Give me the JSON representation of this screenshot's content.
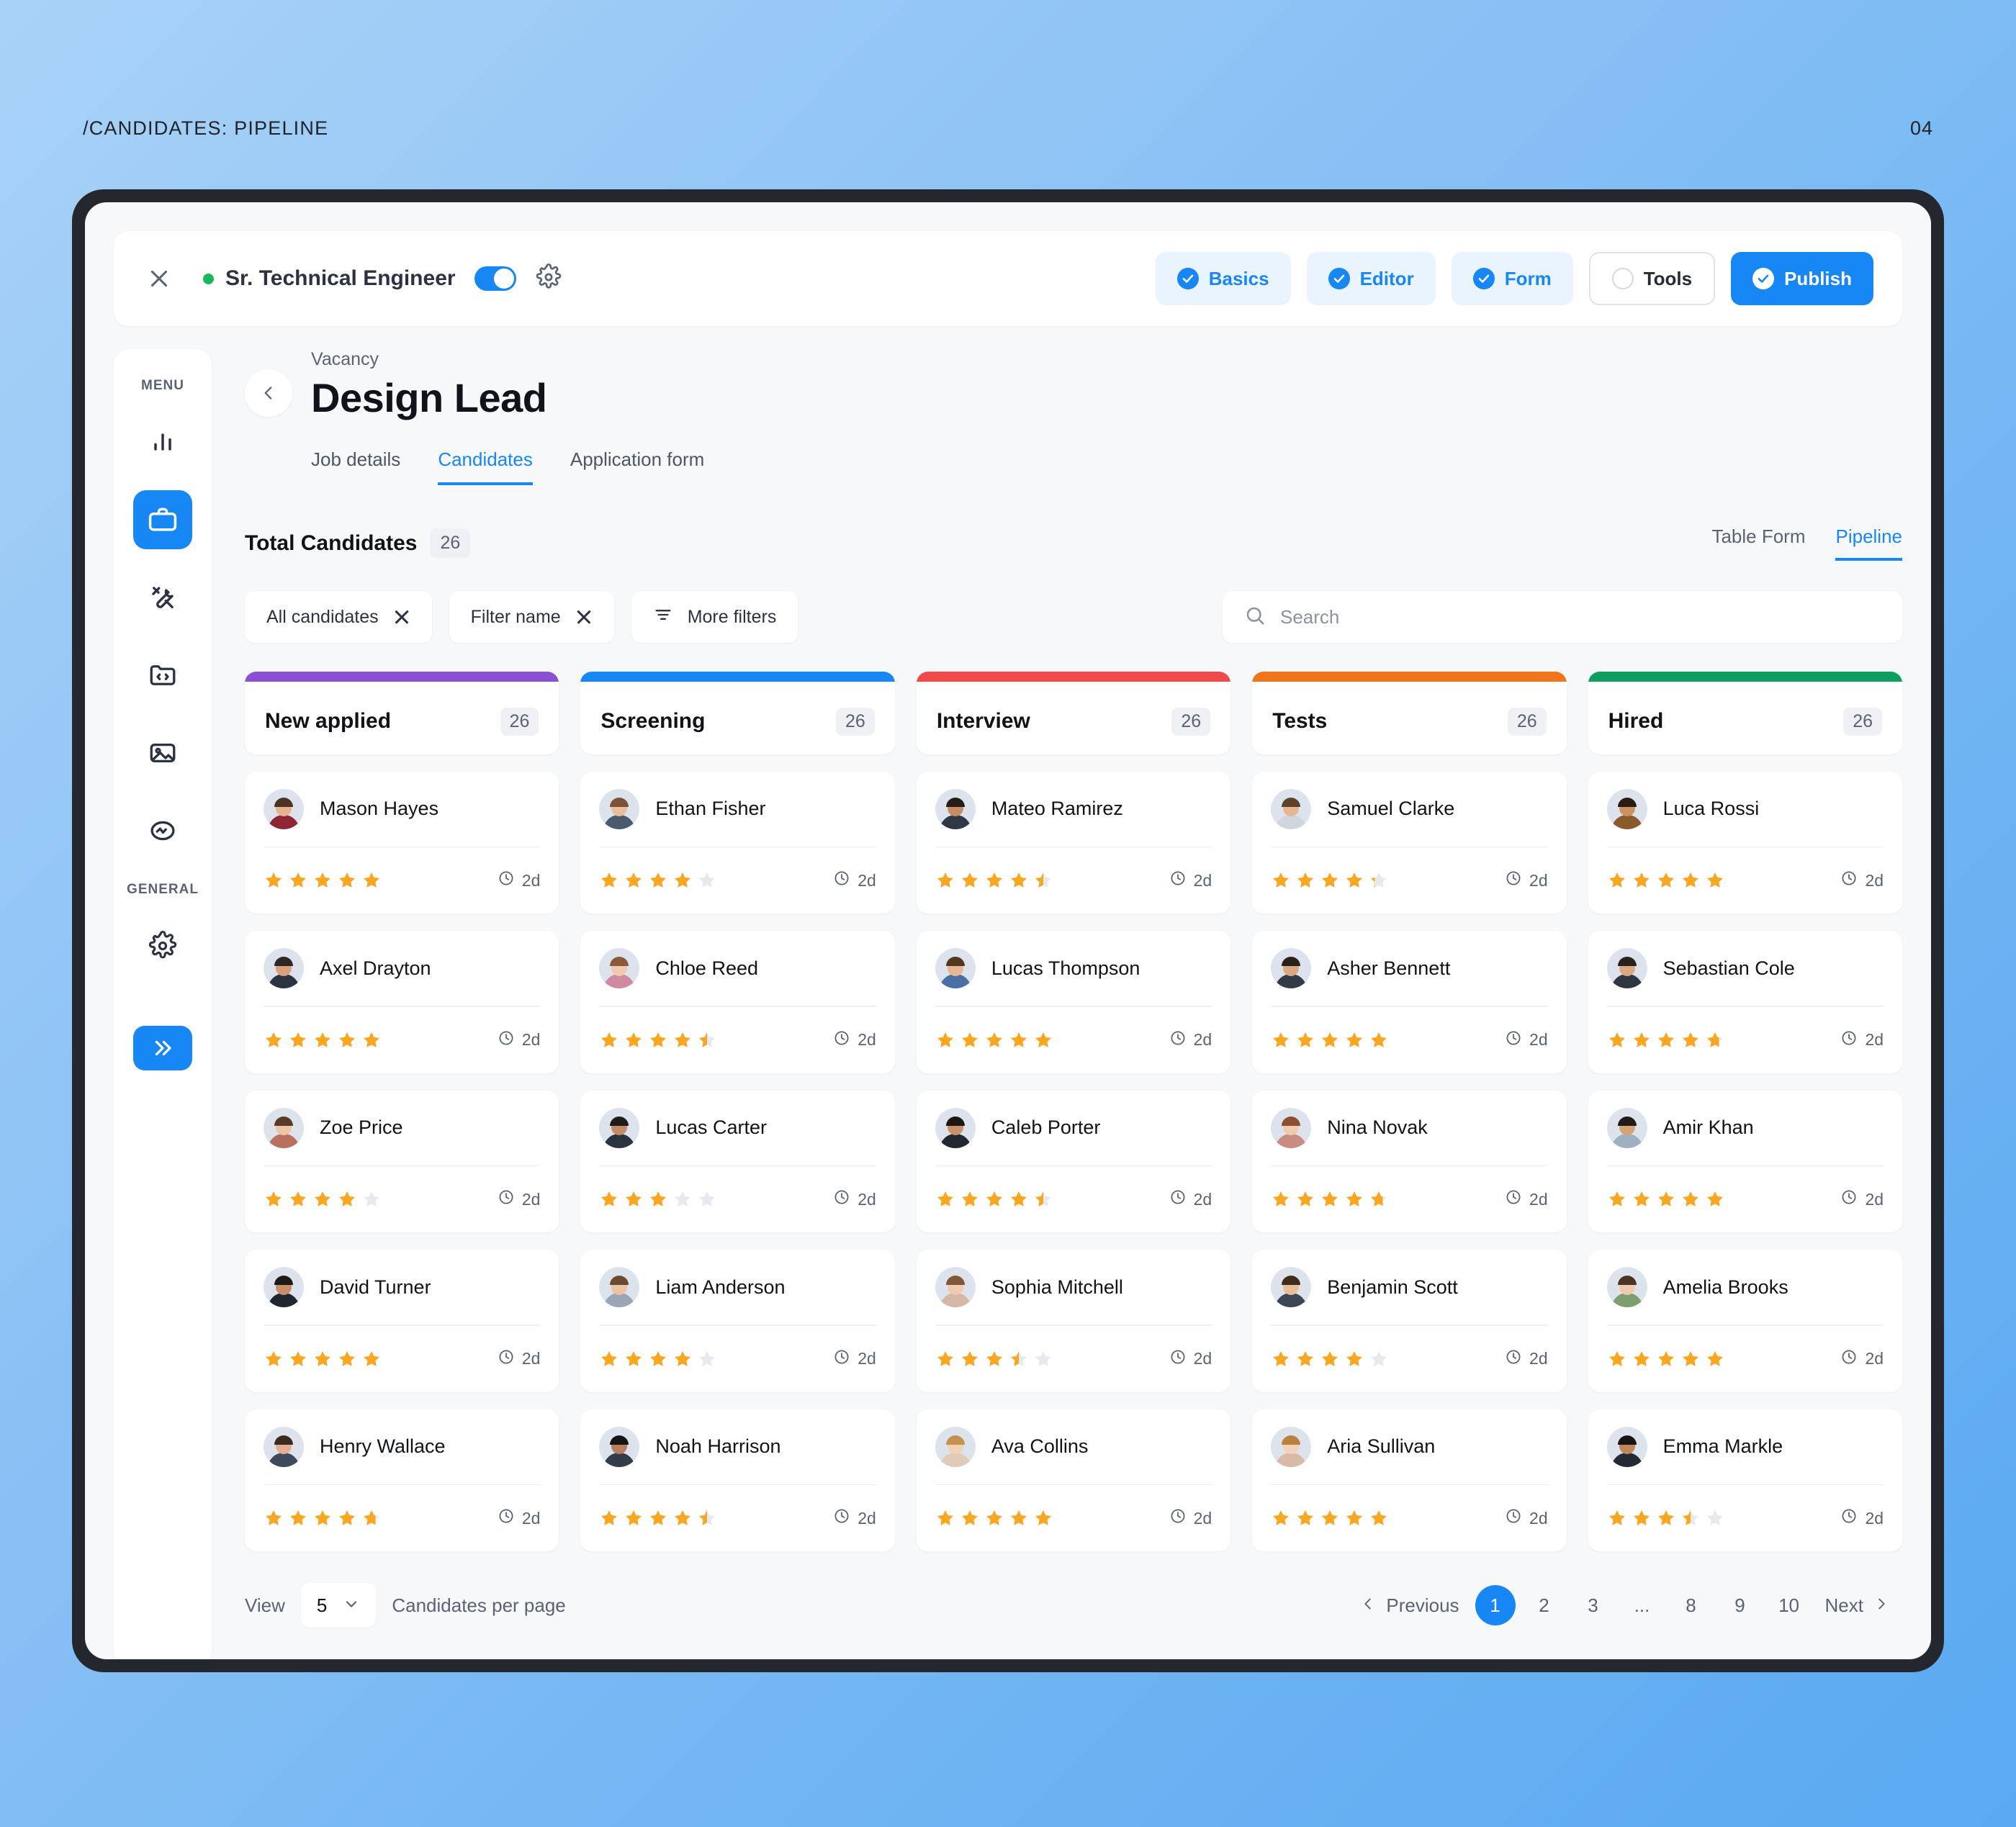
{
  "page": {
    "caption": "/CANDIDATES: PIPELINE",
    "number": "04"
  },
  "topbar": {
    "close_icon": "close-icon",
    "job_title": "Sr. Technical Engineer",
    "toggle_state": "on",
    "gear_icon": "gear-icon",
    "steps": [
      {
        "label": "Basics",
        "state": "done"
      },
      {
        "label": "Editor",
        "state": "done"
      },
      {
        "label": "Form",
        "state": "done"
      },
      {
        "label": "Tools",
        "state": "pending"
      },
      {
        "label": "Publish",
        "state": "primary"
      }
    ]
  },
  "sidebar": {
    "menu_label": "MENU",
    "general_label": "GENERAL",
    "items": [
      {
        "icon": "bar-chart-icon",
        "active": false
      },
      {
        "icon": "briefcase-icon",
        "active": true
      },
      {
        "icon": "tools-icon",
        "active": false
      },
      {
        "icon": "code-folder-icon",
        "active": false
      },
      {
        "icon": "image-icon",
        "active": false
      },
      {
        "icon": "wave-circle-icon",
        "active": false
      }
    ],
    "general_items": [
      {
        "icon": "gear-icon",
        "active": false
      }
    ],
    "expand_icon": "chevrons-right-icon"
  },
  "vacancy": {
    "back_icon": "chevron-left-icon",
    "subtitle": "Vacancy",
    "title": "Design Lead",
    "tabs": [
      {
        "label": "Job details",
        "active": false
      },
      {
        "label": "Candidates",
        "active": true
      },
      {
        "label": "Application form",
        "active": false
      }
    ]
  },
  "totals": {
    "label": "Total Candidates",
    "count": "26"
  },
  "view_switch": [
    {
      "label": "Table Form",
      "active": false
    },
    {
      "label": "Pipeline",
      "active": true
    }
  ],
  "filters": {
    "chips": [
      {
        "label": "All candidates",
        "icon": "close-icon"
      },
      {
        "label": "Filter name",
        "icon": "close-icon"
      }
    ],
    "more_filters": {
      "label": "More filters",
      "icon": "filter-icon"
    }
  },
  "search": {
    "placeholder": "Search",
    "value": "",
    "icon": "search-icon"
  },
  "pipeline": {
    "columns": [
      {
        "name": "New applied",
        "count": "26",
        "color": "#8b4fd6",
        "cards": [
          {
            "name": "Mason Hayes",
            "rating": 5,
            "time": "2d",
            "skin": "#e8b28e",
            "hair": "#4a3426",
            "shirt": "#8f2433"
          },
          {
            "name": "Axel Drayton",
            "rating": 5,
            "time": "2d",
            "skin": "#d9a07c",
            "hair": "#2e2723",
            "shirt": "#2c3340"
          },
          {
            "name": "Zoe Price",
            "rating": 4,
            "time": "2d",
            "skin": "#eec4a6",
            "hair": "#5a3a28",
            "shirt": "#b9715f"
          },
          {
            "name": "David Turner",
            "rating": 5,
            "time": "2d",
            "skin": "#c98d6a",
            "hair": "#1d1a18",
            "shirt": "#1f2630"
          },
          {
            "name": "Henry Wallace",
            "rating": 4.75,
            "time": "2d",
            "skin": "#e2b091",
            "hair": "#3b2a1f",
            "shirt": "#3d4a5c"
          }
        ]
      },
      {
        "name": "Screening",
        "count": "26",
        "color": "#1787f5",
        "cards": [
          {
            "name": "Ethan Fisher",
            "rating": 4,
            "time": "2d",
            "skin": "#e9bd9b",
            "hair": "#7a5436",
            "shirt": "#4b5a6d"
          },
          {
            "name": "Chloe Reed",
            "rating": 4.5,
            "time": "2d",
            "skin": "#f0c9ae",
            "hair": "#8a5a3b",
            "shirt": "#cf8aa0"
          },
          {
            "name": "Lucas Carter",
            "rating": 3,
            "time": "2d",
            "skin": "#c58a66",
            "hair": "#201c19",
            "shirt": "#2b3240"
          },
          {
            "name": "Liam Anderson",
            "rating": 4,
            "time": "2d",
            "skin": "#edc3a4",
            "hair": "#6b4b30",
            "shirt": "#9aa6b5"
          },
          {
            "name": "Noah Harrison",
            "rating": 4.5,
            "time": "2d",
            "skin": "#b97f5c",
            "hair": "#161414",
            "shirt": "#333c4a"
          }
        ]
      },
      {
        "name": "Interview",
        "count": "26",
        "color": "#f04a4a",
        "cards": [
          {
            "name": "Mateo Ramirez",
            "rating": 4.5,
            "time": "2d",
            "skin": "#c68d63",
            "hair": "#241c16",
            "shirt": "#2f3845"
          },
          {
            "name": "Lucas Thompson",
            "rating": 5,
            "time": "2d",
            "skin": "#e7b693",
            "hair": "#51381f",
            "shirt": "#4a6fa5"
          },
          {
            "name": "Caleb Porter",
            "rating": 4.5,
            "time": "2d",
            "skin": "#c9906c",
            "hair": "#1b1715",
            "shirt": "#23272f"
          },
          {
            "name": "Sophia Mitchell",
            "rating": 3.5,
            "time": "2d",
            "skin": "#f0cbb0",
            "hair": "#7f5737",
            "shirt": "#d6b6a6"
          },
          {
            "name": "Ava Collins",
            "rating": 5,
            "time": "2d",
            "skin": "#f2d0b6",
            "hair": "#c2924e",
            "shirt": "#e0cab8"
          }
        ]
      },
      {
        "name": "Tests",
        "count": "26",
        "color": "#f3751b",
        "cards": [
          {
            "name": "Samuel Clarke",
            "rating": 4.25,
            "time": "2d",
            "skin": "#e5b593",
            "hair": "#5e4228",
            "shirt": "#cfd6de"
          },
          {
            "name": "Asher Bennett",
            "rating": 5,
            "time": "2d",
            "skin": "#dba881",
            "hair": "#2a211a",
            "shirt": "#333b47"
          },
          {
            "name": "Nina Novak",
            "rating": 4.75,
            "time": "2d",
            "skin": "#f1cbaf",
            "hair": "#8c4f30",
            "shirt": "#c98c84"
          },
          {
            "name": "Benjamin Scott",
            "rating": 4,
            "time": "2d",
            "skin": "#e8bd9a",
            "hair": "#3f2c1d",
            "shirt": "#3c4654"
          },
          {
            "name": "Aria Sullivan",
            "rating": 5,
            "time": "2d",
            "skin": "#f3d2b9",
            "hair": "#b8813f",
            "shirt": "#d9b9a8"
          }
        ]
      },
      {
        "name": "Hired",
        "count": "26",
        "color": "#0e9f5f",
        "cards": [
          {
            "name": "Luca Rossi",
            "rating": 5,
            "time": "2d",
            "skin": "#cd9263",
            "hair": "#2b1d12",
            "shirt": "#8b5a2b"
          },
          {
            "name": "Sebastian Cole",
            "rating": 4.75,
            "time": "2d",
            "skin": "#dba882",
            "hair": "#29211b",
            "shirt": "#2e3642"
          },
          {
            "name": "Amir Khan",
            "rating": 5,
            "time": "2d",
            "skin": "#d5a279",
            "hair": "#221a14",
            "shirt": "#9fb0c2"
          },
          {
            "name": "Amelia Brooks",
            "rating": 5,
            "time": "2d",
            "skin": "#efcab0",
            "hair": "#4d3322",
            "shirt": "#7c9f6d"
          },
          {
            "name": "Emma Markle",
            "rating": 3.5,
            "time": "2d",
            "skin": "#c2865c",
            "hair": "#1a1412",
            "shirt": "#232a33"
          }
        ]
      }
    ]
  },
  "footer": {
    "view_label": "View",
    "per_page_value": "5",
    "per_page_suffix": "Candidates per page",
    "previous_label": "Previous",
    "next_label": "Next",
    "pages": [
      "1",
      "2",
      "3",
      "...",
      "8",
      "9",
      "10"
    ],
    "active_page": "1"
  },
  "colors": {
    "accent": "#1787f5",
    "star": "#f9a722",
    "star_empty": "#e6e9ef",
    "status_green": "#17b95a"
  }
}
